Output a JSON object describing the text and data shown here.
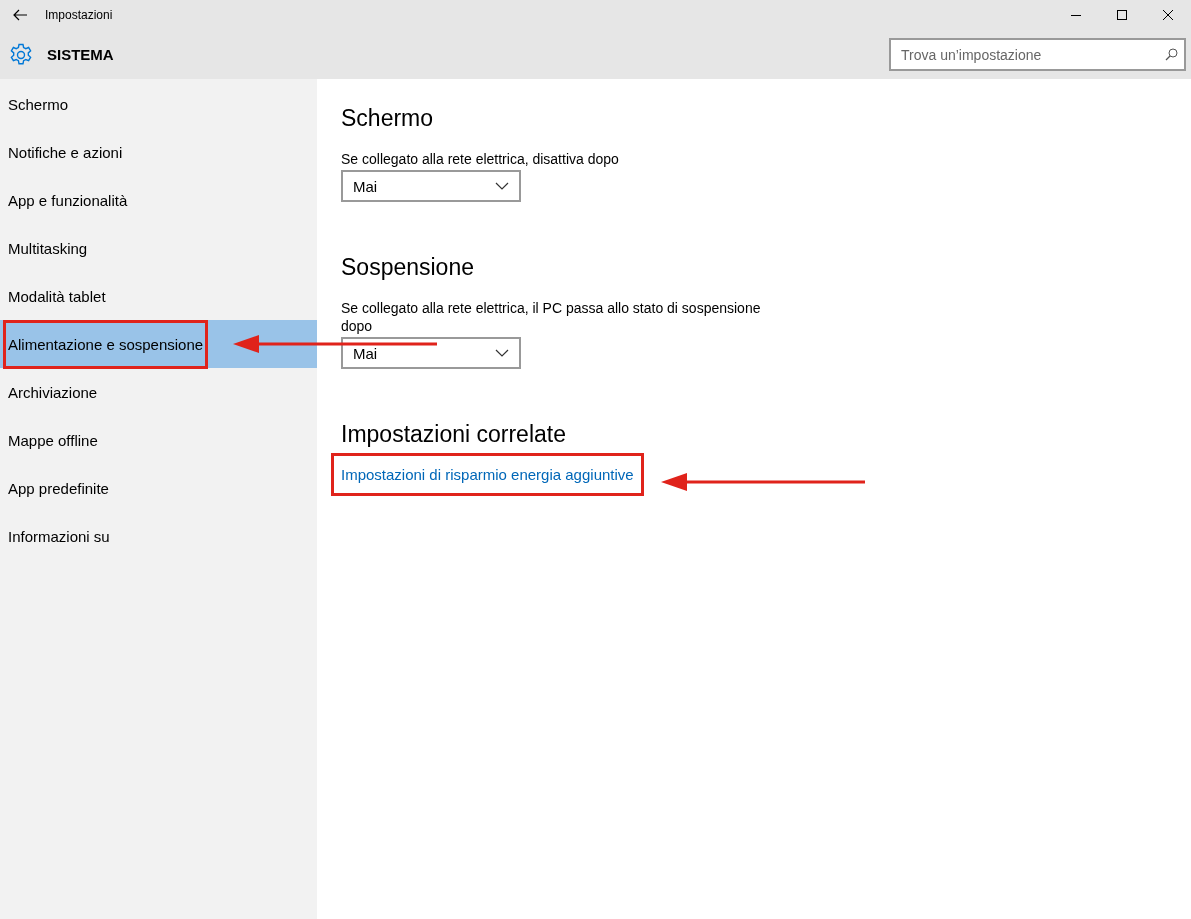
{
  "window": {
    "title": "Impostazioni"
  },
  "header": {
    "title": "SISTEMA",
    "search": {
      "placeholder": "Trova un’impostazione"
    }
  },
  "sidebar": {
    "items": [
      {
        "label": "Schermo",
        "selected": false,
        "highlighted": false
      },
      {
        "label": "Notifiche e azioni",
        "selected": false,
        "highlighted": false
      },
      {
        "label": "App e funzionalità",
        "selected": false,
        "highlighted": false
      },
      {
        "label": "Multitasking",
        "selected": false,
        "highlighted": false
      },
      {
        "label": "Modalità tablet",
        "selected": false,
        "highlighted": false
      },
      {
        "label": "Alimentazione e sospensione",
        "selected": true,
        "highlighted": true
      },
      {
        "label": "Archiviazione",
        "selected": false,
        "highlighted": false
      },
      {
        "label": "Mappe offline",
        "selected": false,
        "highlighted": false
      },
      {
        "label": "App predefinite",
        "selected": false,
        "highlighted": false
      },
      {
        "label": "Informazioni su",
        "selected": false,
        "highlighted": false
      }
    ]
  },
  "sections": [
    {
      "kind": "dropdown",
      "heading": "Schermo",
      "label": "Se collegato alla rete elettrica, disattiva dopo",
      "value": "Mai"
    },
    {
      "kind": "dropdown",
      "heading": "Sospensione",
      "label": "Se collegato alla rete elettrica, il PC passa allo stato di sospensione dopo",
      "value": "Mai"
    },
    {
      "kind": "link",
      "heading": "Impostazioni correlate",
      "link": {
        "text": "Impostazioni di risparmio energia aggiuntive",
        "highlighted": true
      }
    }
  ]
}
